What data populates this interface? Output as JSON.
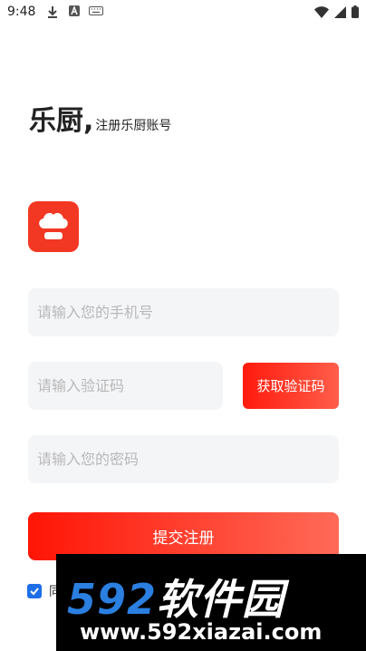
{
  "status_bar": {
    "time": "9:48"
  },
  "header": {
    "brand": "乐厨,",
    "subtitle": "注册乐厨账号"
  },
  "form": {
    "phone_placeholder": "请输入您的手机号",
    "code_placeholder": "请输入验证码",
    "get_code_label": "获取验证码",
    "password_placeholder": "请输入您的密码",
    "submit_label": "提交注册"
  },
  "agreement": {
    "text": "同"
  },
  "watermark": {
    "num": "592",
    "cn": "软件园",
    "url": "www.592xiazai.com"
  },
  "colors": {
    "accent": "#f23822",
    "checkbox": "#1e6ee8",
    "watermark_blue": "#2a7fe0"
  },
  "icons": {
    "download": "download-icon",
    "a": "a-letter-icon",
    "keyboard": "keyboard-icon",
    "wifi": "wifi-icon",
    "signal": "signal-icon",
    "battery": "battery-icon",
    "logo": "chef-hat-icon"
  }
}
